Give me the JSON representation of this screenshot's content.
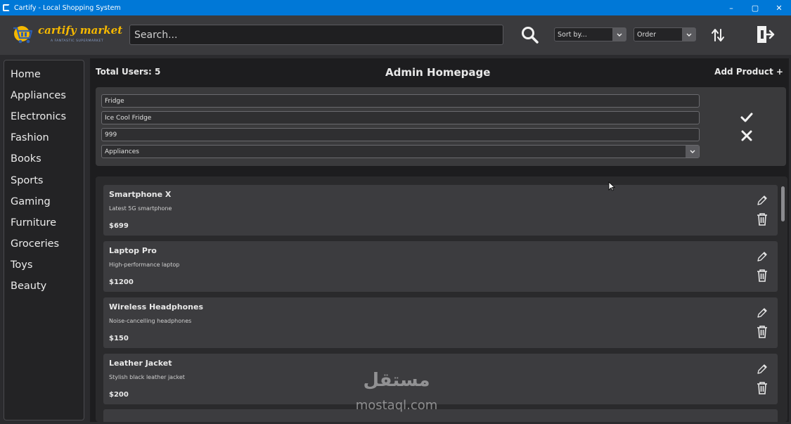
{
  "window": {
    "title": "Cartify - Local Shopping System",
    "controls": {
      "minimize": "–",
      "maximize": "▢",
      "close": "✕"
    },
    "accent_color": "#0078d7"
  },
  "header": {
    "logo": {
      "brand": "cartify market",
      "tagline": "A FANTASTIC SUPERMARKET",
      "icon": "cart-logo-icon"
    },
    "search": {
      "placeholder": "Search...",
      "value": ""
    },
    "search_icon": "search-icon",
    "sort_select": {
      "selected": "Sort by..."
    },
    "order_select": {
      "selected": "Order"
    },
    "sort_toggle_icon": "sort-arrows-icon",
    "logout_icon": "logout-icon"
  },
  "sidebar": {
    "items": [
      {
        "label": "Home"
      },
      {
        "label": "Appliances"
      },
      {
        "label": "Electronics"
      },
      {
        "label": "Fashion"
      },
      {
        "label": "Books"
      },
      {
        "label": "Sports"
      },
      {
        "label": "Gaming"
      },
      {
        "label": "Furniture"
      },
      {
        "label": "Groceries"
      },
      {
        "label": "Toys"
      },
      {
        "label": "Beauty"
      }
    ]
  },
  "main": {
    "total_users": "Total Users: 5",
    "title": "Admin Homepage",
    "add_product": "Add Product +",
    "form": {
      "name": "Fridge",
      "description": "Ice Cool Fridge",
      "price": "999",
      "category": "Appliances"
    },
    "products": [
      {
        "name": "Smartphone X",
        "description": "Latest 5G smartphone",
        "price": "$699"
      },
      {
        "name": "Laptop Pro",
        "description": "High-performance laptop",
        "price": "$1200"
      },
      {
        "name": "Wireless Headphones",
        "description": "Noise-cancelling headphones",
        "price": "$150"
      },
      {
        "name": "Leather Jacket",
        "description": "Stylish black leather jacket",
        "price": "$200"
      }
    ]
  },
  "watermark": {
    "arabic": "مستقل",
    "latin": "mostaql.com"
  },
  "colors": {
    "logo_yellow": "#f5b800",
    "panel": "#3a3a3c",
    "background": "#1d1d1f"
  }
}
